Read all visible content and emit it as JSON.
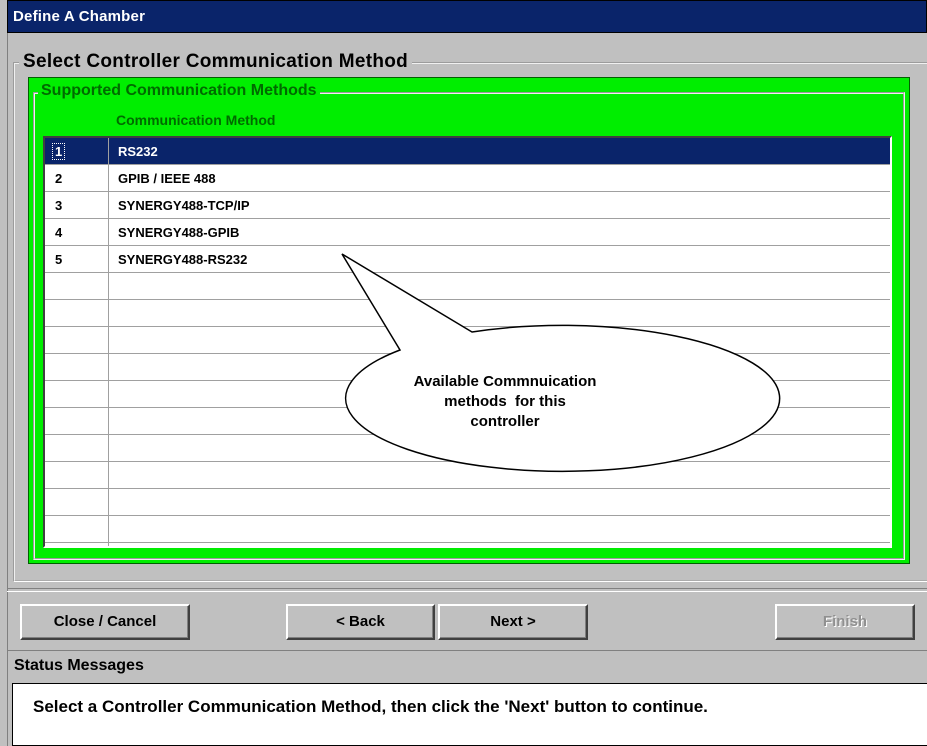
{
  "window": {
    "title": "Define A Chamber"
  },
  "section": {
    "title": "Select Controller Communication Method"
  },
  "methods_panel": {
    "title": "Supported Communication Methods",
    "column_header": "Communication Method",
    "rows": [
      {
        "num": "1",
        "method": "RS232",
        "selected": true
      },
      {
        "num": "2",
        "method": "GPIB / IEEE 488",
        "selected": false
      },
      {
        "num": "3",
        "method": "SYNERGY488-TCP/IP",
        "selected": false
      },
      {
        "num": "4",
        "method": "SYNERGY488-GPIB",
        "selected": false
      },
      {
        "num": "5",
        "method": "SYNERGY488-RS232",
        "selected": false
      }
    ]
  },
  "callout": {
    "lines": [
      "Available Commnuication",
      "methods  for this",
      "controller"
    ]
  },
  "buttons": {
    "close": "Close / Cancel",
    "back": "< Back",
    "next": "Next >",
    "finish": "Finish"
  },
  "status": {
    "label": "Status Messages",
    "message": "Select a Controller Communication Method,  then click the 'Next' button to continue."
  },
  "colors": {
    "titlebar": "#0a246a",
    "panel_green": "#00ee00",
    "selection": "#0a246a",
    "dialog": "#c0c0c0"
  }
}
